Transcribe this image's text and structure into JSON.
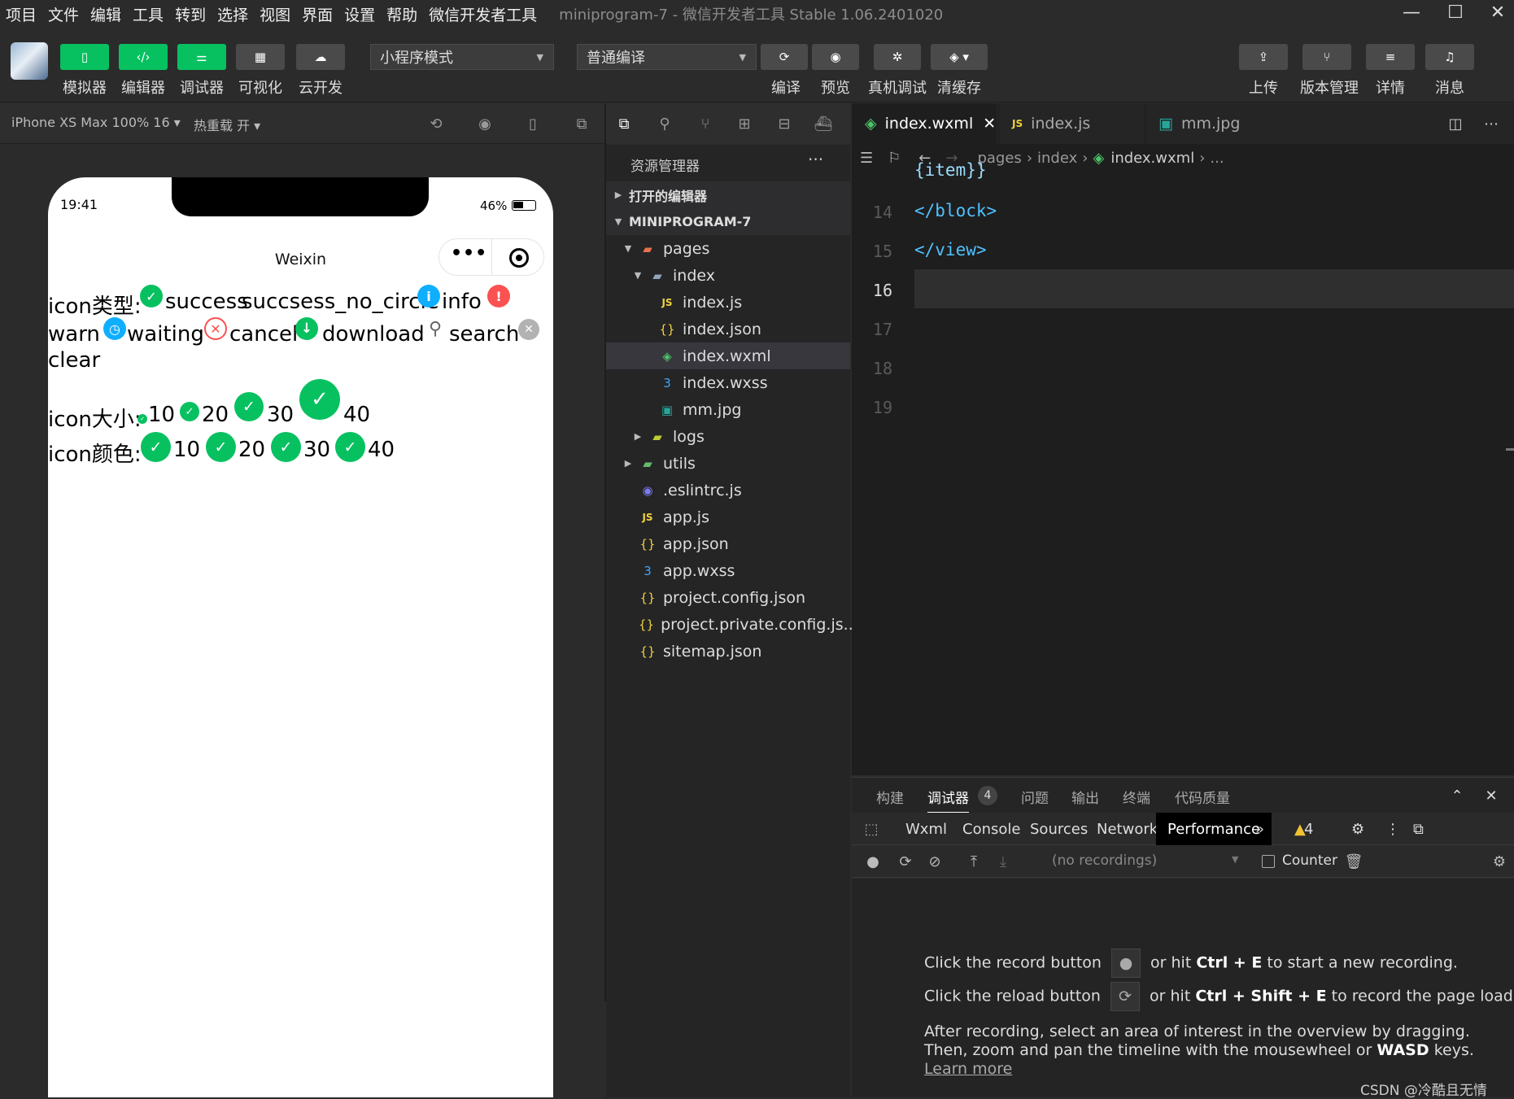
{
  "menu": [
    "项目",
    "文件",
    "编辑",
    "工具",
    "转到",
    "选择",
    "视图",
    "界面",
    "设置",
    "帮助",
    "微信开发者工具"
  ],
  "window_title": "miniprogram-7 - 微信开发者工具 Stable 1.06.2401020",
  "toolbar": {
    "buttons": [
      {
        "label": "模拟器",
        "icon": "phone-icon"
      },
      {
        "label": "编辑器",
        "icon": "code-icon"
      },
      {
        "label": "调试器",
        "icon": "sliders-icon"
      },
      {
        "label": "可视化",
        "icon": "layout-icon"
      },
      {
        "label": "云开发",
        "icon": "cloud-icon"
      }
    ],
    "mode_select": "小程序模式",
    "compile_select": "普通编译",
    "compile_label": "编译",
    "preview_label": "预览",
    "remote_debug_label": "真机调试",
    "clear_cache_label": "清缓存",
    "upload_label": "上传",
    "version_label": "版本管理",
    "details_label": "详情",
    "messages_label": "消息"
  },
  "simulator": {
    "device": "iPhone XS Max 100% 16 ▾",
    "hot_reload": "热重载 开 ▾",
    "status_time": "19:41",
    "battery": "46%",
    "nav_title": "Weixin",
    "capsule_dots": "•••",
    "type_prefix": "icon类型:",
    "type_labels": [
      "success",
      "succsess_no_circle",
      "info",
      "warn",
      "waiting",
      "cancel",
      "download",
      "search",
      "clear"
    ],
    "size_prefix": "icon大小:",
    "sizes": [
      "10",
      "20",
      "30",
      "40"
    ],
    "color_prefix": "icon颜色:",
    "colors": [
      "10",
      "20",
      "30",
      "40"
    ]
  },
  "explorer": {
    "title": "资源管理器",
    "more": "···",
    "open_editors": "打开的编辑器",
    "project": "MINIPROGRAM-7",
    "tree": [
      {
        "name": "pages",
        "type": "folder"
      },
      {
        "name": "index",
        "type": "folder"
      },
      {
        "name": "index.js",
        "type": "js"
      },
      {
        "name": "index.json",
        "type": "json"
      },
      {
        "name": "index.wxml",
        "type": "wxml"
      },
      {
        "name": "index.wxss",
        "type": "wxss"
      },
      {
        "name": "mm.jpg",
        "type": "img"
      },
      {
        "name": "logs",
        "type": "folder"
      },
      {
        "name": "utils",
        "type": "folder"
      },
      {
        "name": ".eslintrc.js",
        "type": "eslint"
      },
      {
        "name": "app.js",
        "type": "js"
      },
      {
        "name": "app.json",
        "type": "json"
      },
      {
        "name": "app.wxss",
        "type": "wxss"
      },
      {
        "name": "project.config.json",
        "type": "json"
      },
      {
        "name": "project.private.config.js...",
        "type": "json"
      },
      {
        "name": "sitemap.json",
        "type": "json"
      }
    ]
  },
  "editor": {
    "tabs": [
      "index.wxml",
      "index.js",
      "mm.jpg"
    ],
    "breadcrumb": [
      "pages",
      "index",
      "index.wxml",
      "..."
    ],
    "partial_line": "{item}}",
    "lines": [
      {
        "n": "14",
        "code": "</block>"
      },
      {
        "n": "15",
        "code": "</view>"
      },
      {
        "n": "16",
        "code": ""
      },
      {
        "n": "17",
        "code": ""
      },
      {
        "n": "18",
        "code": ""
      },
      {
        "n": "19",
        "code": ""
      }
    ]
  },
  "devtools": {
    "top_tabs": [
      "构建",
      "调试器",
      "问题",
      "输出",
      "终端",
      "代码质量"
    ],
    "debugger_badge": "4",
    "panels": [
      "Wxml",
      "Console",
      "Sources",
      "Network",
      "Performance"
    ],
    "warn_count": "4",
    "recordings": "(no recordings)",
    "counter_label": "Counter",
    "msg1_a": "Click the record button",
    "msg1_b": "or hit",
    "msg1_key": "Ctrl + E",
    "msg1_c": "to start a new recording.",
    "msg2_a": "Click the reload button",
    "msg2_b": "or hit",
    "msg2_key": "Ctrl + Shift + E",
    "msg2_c": "to record the page load.",
    "msg3": "After recording, select an area of interest in the overview by dragging.",
    "msg4_a": "Then, zoom and pan the timeline with the mousewheel or",
    "msg4_key": "WASD",
    "msg4_b": "keys.",
    "learn_more": "Learn more"
  },
  "watermark": "CSDN @冷酷且无情"
}
